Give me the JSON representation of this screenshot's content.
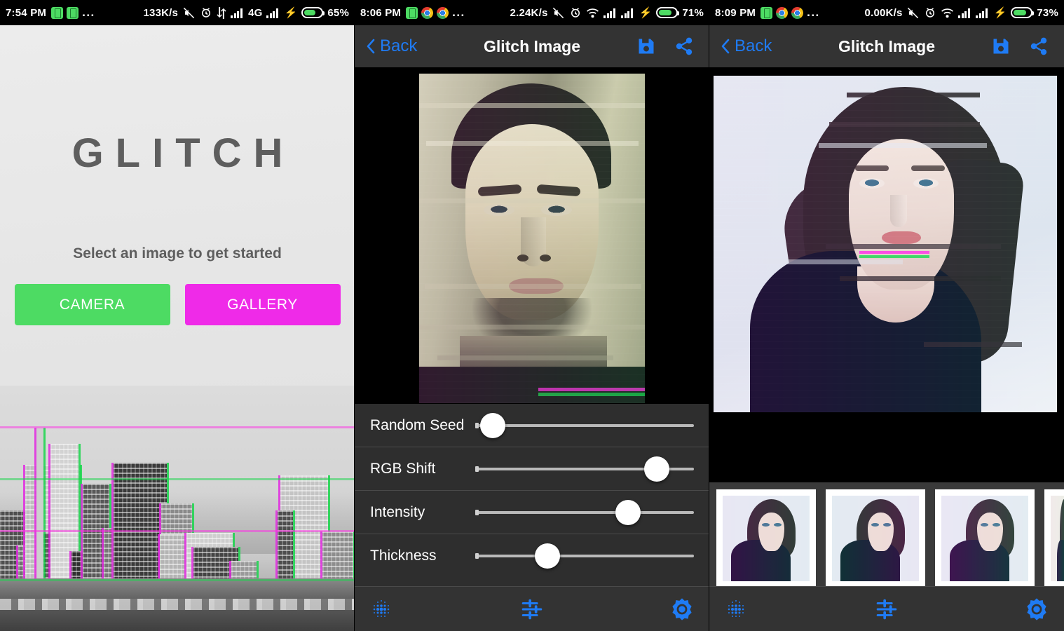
{
  "accent": "#1f7bf4",
  "panels": [
    {
      "name": "splash",
      "statusbar": {
        "time": "7:54 PM",
        "speed": "133K/s",
        "network": "4G",
        "battery_pct": "65%",
        "battery_level": 62,
        "app_icons": [
          "battery-saver-icon",
          "battery-saver-icon"
        ],
        "overflow": "...",
        "icons": [
          "mute-icon",
          "alarm-icon",
          "sync-icon",
          "signal-icon",
          "signal-icon",
          "charging-bolt-icon",
          "battery-icon"
        ]
      },
      "title": "GLITCH",
      "subtitle": "Select an image to get started",
      "buttons": [
        {
          "label": "CAMERA",
          "color": "#4ddb63"
        },
        {
          "label": "GALLERY",
          "color": "#ef2ae8"
        }
      ]
    },
    {
      "name": "editor-adjust",
      "statusbar": {
        "time": "8:06 PM",
        "speed": "2.24K/s",
        "network": "",
        "battery_pct": "71%",
        "battery_level": 68,
        "app_icons": [
          "battery-saver-icon",
          "chrome-icon",
          "chrome-icon"
        ],
        "overflow": "...",
        "icons": [
          "mute-icon",
          "alarm-icon",
          "wifi-icon",
          "signal-icon",
          "signal-icon",
          "charging-bolt-icon",
          "battery-icon"
        ]
      },
      "appbar": {
        "back_label": "Back",
        "title": "Glitch Image",
        "actions": [
          "save-icon",
          "share-icon"
        ]
      },
      "sliders": [
        {
          "label": "Random Seed",
          "value": 8
        },
        {
          "label": "RGB Shift",
          "value": 83
        },
        {
          "label": "Intensity",
          "value": 70
        },
        {
          "label": "Thickness",
          "value": 33
        }
      ],
      "toolbar": [
        "dither-pattern-icon",
        "tune-sliders-icon",
        "brightness-gear-icon"
      ]
    },
    {
      "name": "editor-presets",
      "statusbar": {
        "time": "8:09 PM",
        "speed": "0.00K/s",
        "network": "",
        "battery_pct": "73%",
        "battery_level": 70,
        "app_icons": [
          "battery-saver-icon",
          "chrome-icon",
          "chrome-icon"
        ],
        "overflow": "...",
        "icons": [
          "mute-icon",
          "alarm-icon",
          "wifi-icon",
          "signal-icon",
          "signal-icon",
          "charging-bolt-icon",
          "battery-icon"
        ]
      },
      "appbar": {
        "back_label": "Back",
        "title": "Glitch Image",
        "actions": [
          "save-icon",
          "share-icon"
        ]
      },
      "presets": [
        {
          "name": "preset-1",
          "selected": true
        },
        {
          "name": "preset-2",
          "selected": false
        },
        {
          "name": "preset-3",
          "selected": false
        },
        {
          "name": "preset-4",
          "selected": false
        }
      ],
      "toolbar": [
        "dither-pattern-icon",
        "tune-sliders-icon",
        "brightness-gear-icon"
      ]
    }
  ]
}
